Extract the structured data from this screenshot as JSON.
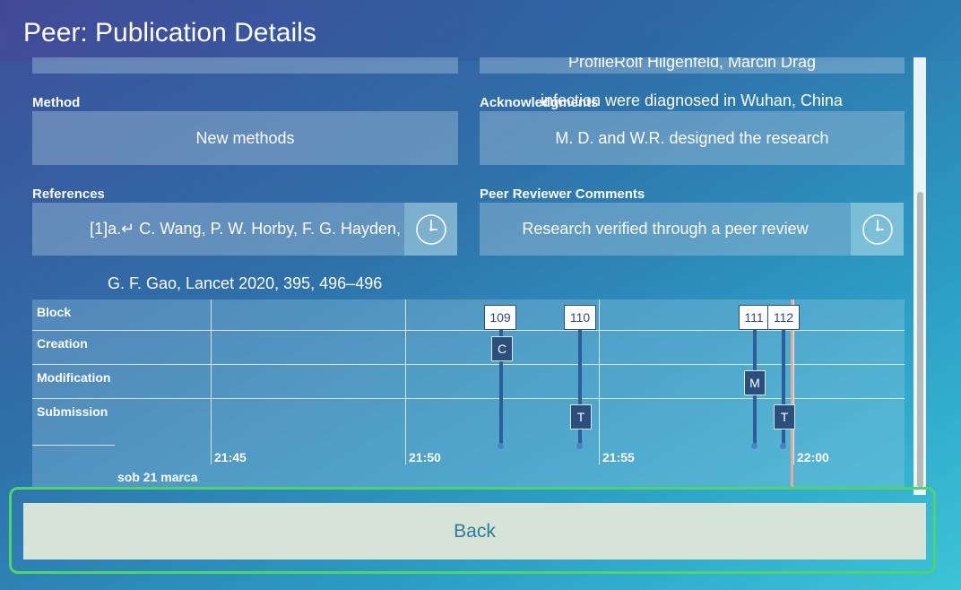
{
  "window": {
    "title": "Peer: Publication Details"
  },
  "top_fields": {
    "left_value": "",
    "right_value": "ProfileRolf Hilgenfeld, Marcin Drag"
  },
  "method": {
    "label": "Method",
    "value": "New methods"
  },
  "acknowledgments": {
    "label": "Acknowledgments",
    "overlay_text": "infection were diagnosed in Wuhan, China",
    "value": "M. D. and W.R. designed the research"
  },
  "references": {
    "label": "References",
    "value": "[1]a.↵ C. Wang, P. W. Horby, F. G. Hayden,",
    "continuation": "G. F. Gao, Lancet 2020, 395, 496–496",
    "history_icon": "clock-icon"
  },
  "peer_comments": {
    "label": "Peer Reviewer Comments",
    "value": "Research verified through a peer review",
    "history_icon": "clock-icon"
  },
  "timeline": {
    "rows": [
      "Block",
      "Creation",
      "Modification",
      "Submission"
    ],
    "time_ticks": [
      "21:45",
      "21:50",
      "21:55",
      "22:00"
    ],
    "date_label": "sob 21 marca",
    "blocks": [
      {
        "number": "109",
        "marker": "C",
        "marker_row": "Creation"
      },
      {
        "number": "110",
        "marker": "T",
        "marker_row": "Submission"
      },
      {
        "number": "111",
        "marker": "M",
        "marker_row": "Modification"
      },
      {
        "number": "112",
        "marker": "T",
        "marker_row": "Submission"
      }
    ]
  },
  "footer": {
    "back_label": "Back"
  },
  "colors": {
    "accent_border": "#4fd46a",
    "button_bg": "#d5e4d7",
    "button_text": "#2d7b97",
    "marker_bg": "#2b4f7d"
  }
}
